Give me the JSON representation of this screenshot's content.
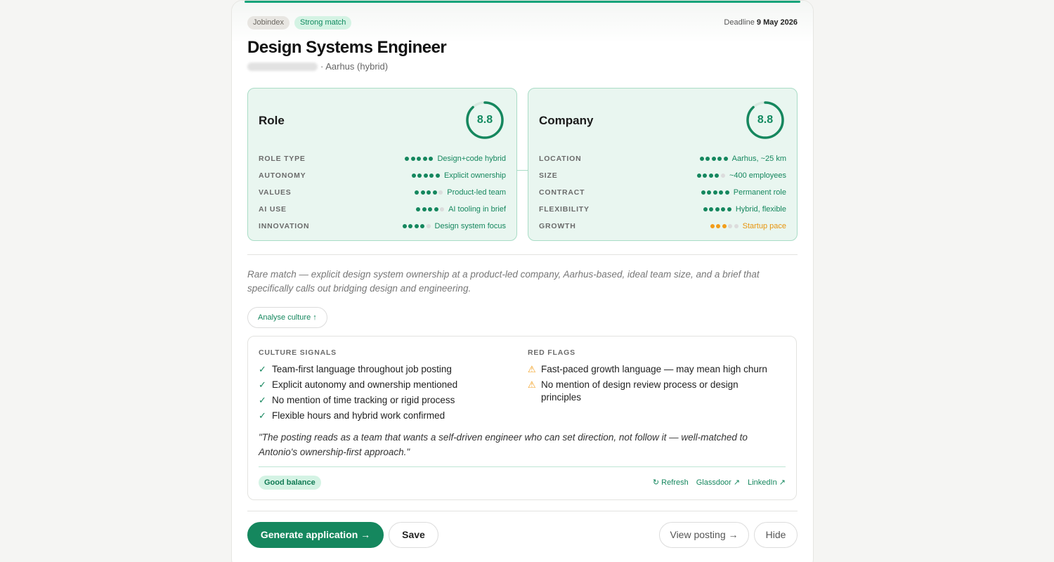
{
  "header": {
    "source": "Jobindex",
    "match": "Strong match",
    "deadline_label": "Deadline",
    "deadline_date": "9 May 2026"
  },
  "job": {
    "title": "Design Systems Engineer",
    "location": "· Aarhus (hybrid)"
  },
  "role": {
    "title": "Role",
    "score": "8.8",
    "score_fraction": 0.88,
    "rows": [
      {
        "label": "ROLE TYPE",
        "value": "Design+code hybrid",
        "rating": 5
      },
      {
        "label": "AUTONOMY",
        "value": "Explicit ownership",
        "rating": 5
      },
      {
        "label": "VALUES",
        "value": "Product-led team",
        "rating": 4
      },
      {
        "label": "AI USE",
        "value": "AI tooling in brief",
        "rating": 4
      },
      {
        "label": "INNOVATION",
        "value": "Design system focus",
        "rating": 4
      }
    ]
  },
  "company": {
    "title": "Company",
    "score": "8.8",
    "score_fraction": 0.88,
    "rows": [
      {
        "label": "LOCATION",
        "value": "Aarhus, ~25 km",
        "rating": 5
      },
      {
        "label": "SIZE",
        "value": "~400 employees",
        "rating": 4
      },
      {
        "label": "CONTRACT",
        "value": "Permanent role",
        "rating": 5
      },
      {
        "label": "FLEXIBILITY",
        "value": "Hybrid, flexible",
        "rating": 5
      },
      {
        "label": "GROWTH",
        "value": "Startup pace",
        "rating": 3,
        "warn": true
      }
    ]
  },
  "summary": "Rare match — explicit design system ownership at a product-led company, Aarhus-based, ideal team size, and a brief that specifically calls out bridging design and engineering.",
  "analyse_label": "Analyse culture ↑",
  "culture": {
    "signals_heading": "CULTURE SIGNALS",
    "signals": [
      "Team-first language throughout job posting",
      "Explicit autonomy and ownership mentioned",
      "No mention of time tracking or rigid process",
      "Flexible hours and hybrid work confirmed"
    ],
    "flags_heading": "RED FLAGS",
    "flags": [
      "Fast-paced growth language — may mean high churn",
      "No mention of design review process or design principles"
    ],
    "quote": "\"The posting reads as a team that wants a self-driven engineer who can set direction, not follow it — well-matched to Antonio's ownership-first approach.\"",
    "balance": "Good balance",
    "links": {
      "refresh": "↻ Refresh",
      "glassdoor": "Glassdoor ↗",
      "linkedin": "LinkedIn ↗"
    }
  },
  "actions": {
    "generate": "Generate application →",
    "save": "Save",
    "view": "View posting →",
    "hide": "Hide"
  },
  "colors": {
    "accent": "#15875e",
    "panel_bg": "#e9f6f0",
    "warning": "#f29d1a"
  }
}
